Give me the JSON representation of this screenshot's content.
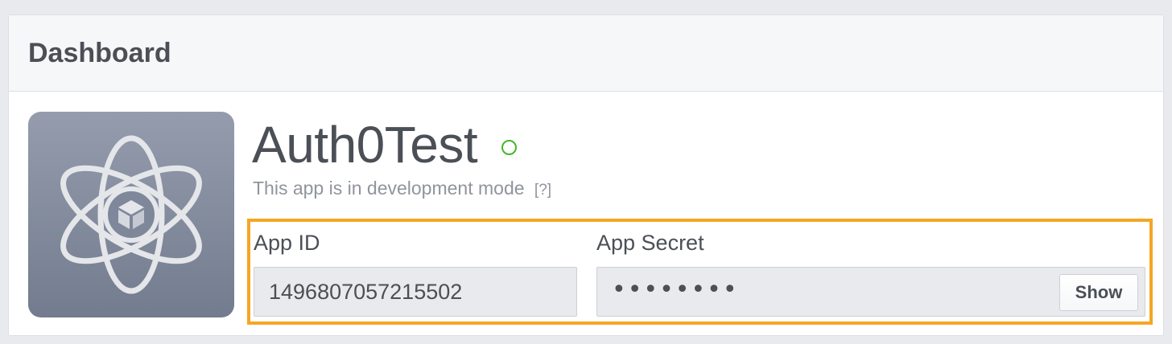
{
  "header": {
    "title": "Dashboard"
  },
  "app": {
    "icon": "atom-cube-icon",
    "name": "Auth0Test",
    "status": "development",
    "status_color": "#42b72a",
    "mode_text": "This app is in development mode",
    "help_link": "[?]"
  },
  "credentials": {
    "highlight_color": "#f5a623",
    "app_id_label": "App ID",
    "app_id_value": "1496807057215502",
    "app_secret_label": "App Secret",
    "app_secret_value": "••••••••",
    "show_button_label": "Show"
  }
}
